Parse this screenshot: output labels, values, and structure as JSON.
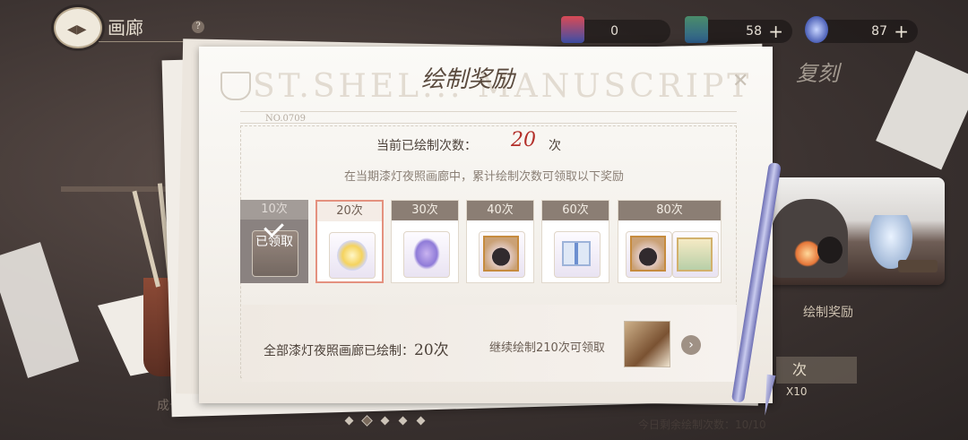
{
  "header": {
    "title": "画廊",
    "help_icon": "?"
  },
  "currencies": [
    {
      "icon": "paint-ticket-icon",
      "value": "0"
    },
    {
      "icon": "paint-ticket-green-icon",
      "value": "58"
    },
    {
      "icon": "diamond-icon",
      "value": "87"
    }
  ],
  "background": {
    "replay_label": "复刻",
    "draw_label": "绘制奖励",
    "draw_button": "次",
    "draw_multi": "X10",
    "today_remaining": "今日剩余绘制次数：10/10",
    "bottom_left_text": "成长记录"
  },
  "modal": {
    "title": "绘制奖励",
    "watermark": "ST.SHEL... MANUSCRIPT",
    "serial": "NO.0709",
    "count_label": "当前已绘制次数：",
    "count_value": "20",
    "count_unit": "次",
    "description": "在当期漆灯夜照画廊中，累计绘制次数可领取以下奖励",
    "tiers": [
      {
        "label": "10次",
        "state": "claimed",
        "stamp": "已领取",
        "items": [
          "coin-icon"
        ]
      },
      {
        "label": "20次",
        "state": "current",
        "items": [
          "sun-badge-icon"
        ]
      },
      {
        "label": "30次",
        "state": "locked",
        "items": [
          "wish-flower-icon"
        ]
      },
      {
        "label": "40次",
        "state": "locked",
        "items": [
          "portrait-frame-icon"
        ]
      },
      {
        "label": "60次",
        "state": "locked",
        "items": [
          "gift-box-icon"
        ]
      },
      {
        "label": "80次",
        "state": "locked",
        "items": [
          "portrait-frame-icon",
          "scene-card-icon"
        ]
      }
    ],
    "footer": {
      "total_label": "全部漆灯夜照画廊已绘制：",
      "total_value": "20次",
      "next_hint": "继续绘制210次可领取",
      "next_icon": "arrow-right-icon"
    }
  },
  "pagination": {
    "count": 5,
    "active": 1
  },
  "colors": {
    "accent_red": "#b32f2a",
    "tier_header": "#8b7e74",
    "current_border": "#e4917f"
  }
}
